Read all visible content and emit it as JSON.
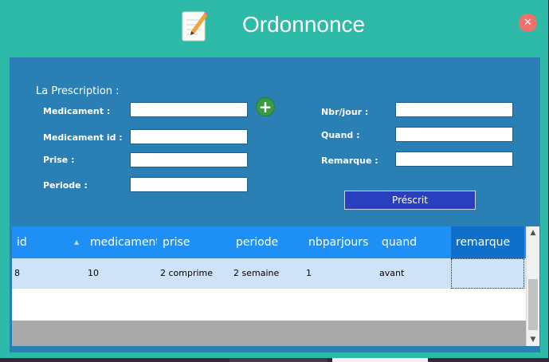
{
  "window": {
    "title": "Ordonnonce",
    "close_glyph": "✕",
    "icon": "notepad-pencil-icon"
  },
  "form": {
    "section_label": "La Prescription :",
    "left": [
      {
        "label": "Medicament :",
        "value": ""
      },
      {
        "label": "Medicament id :",
        "value": ""
      },
      {
        "label": "Prise :",
        "value": ""
      },
      {
        "label": "Periode :",
        "value": ""
      }
    ],
    "right": [
      {
        "label": "Nbr/jour :",
        "value": ""
      },
      {
        "label": "Quand :",
        "value": ""
      },
      {
        "label": "Remarque :",
        "value": ""
      }
    ],
    "add_glyph": "+",
    "submit_label": "Préscrit"
  },
  "grid": {
    "columns": [
      "id",
      "medicament",
      "prise",
      "periode",
      "nbparjours",
      "quand",
      "remarque"
    ],
    "sort_indicator": "▲",
    "rows": [
      [
        "8",
        "10",
        "2 comprime",
        "2 semaine",
        "1",
        "avant",
        ""
      ]
    ]
  },
  "scrollbar": {
    "up": "▲",
    "down": "▼"
  },
  "colors": {
    "window_bg": "#2ebaa8",
    "panel_bg": "#2a7fb4",
    "header_bg": "#1e90f5",
    "row_selected": "#cfe3f8",
    "button_bg": "#2a3fc0"
  }
}
